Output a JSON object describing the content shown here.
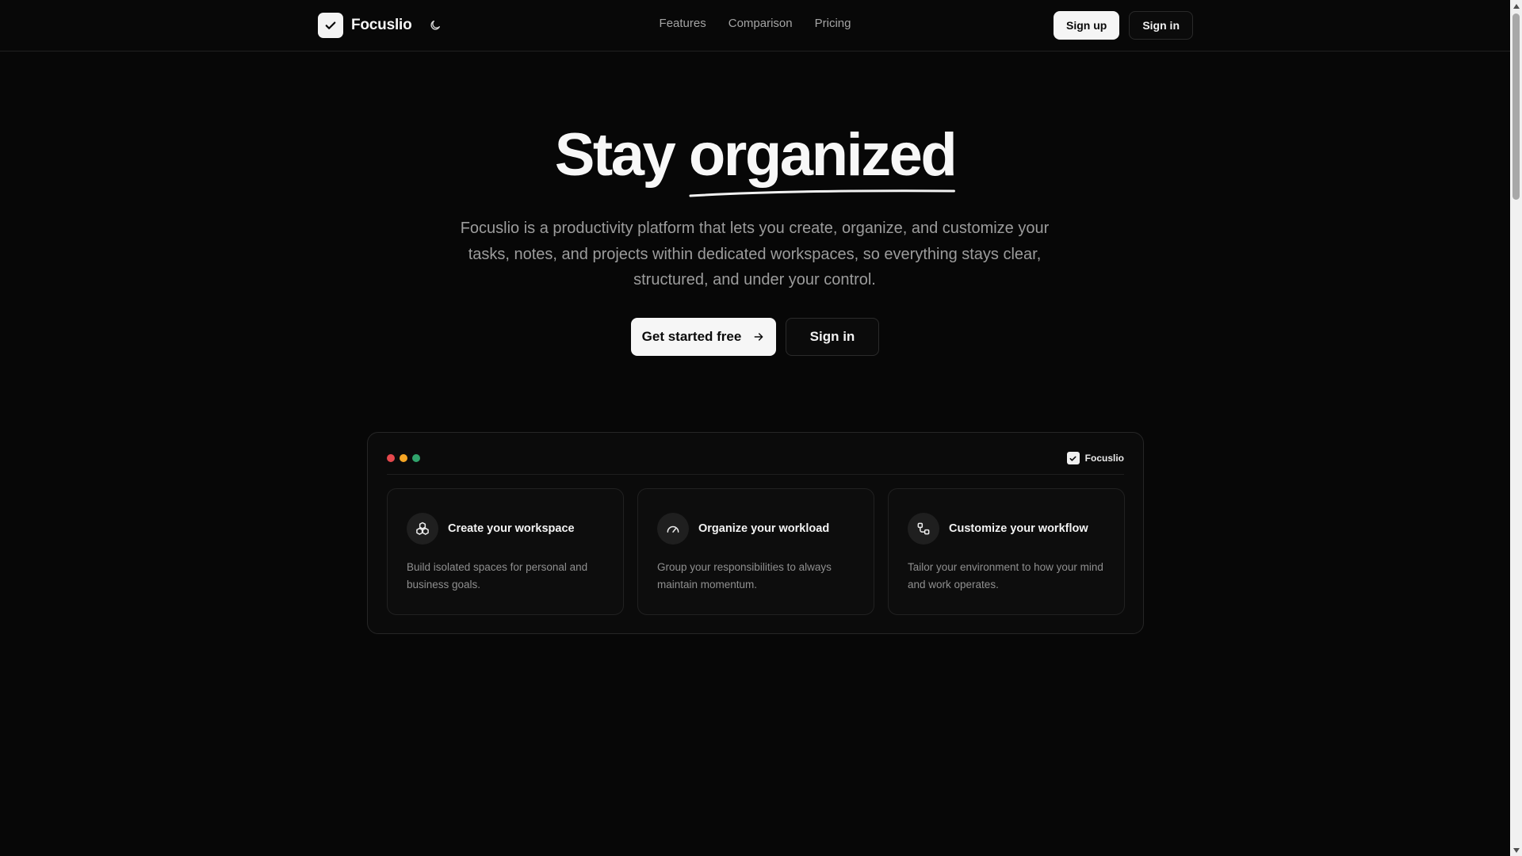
{
  "header": {
    "brand_name": "Focuslio",
    "nav": [
      "Features",
      "Comparison",
      "Pricing"
    ],
    "signup_label": "Sign up",
    "signin_label": "Sign in"
  },
  "hero": {
    "title_part1": "Stay",
    "title_highlight": "organized",
    "description": "Focuslio is a productivity platform that lets you create, organize, and customize your tasks, notes, and projects within dedicated workspaces, so everything stays clear, structured, and under your control.",
    "primary_cta": "Get started free",
    "secondary_cta": "Sign in"
  },
  "preview": {
    "brand_name": "Focuslio",
    "dot_colors": [
      "#e5484d",
      "#f5a524",
      "#30a46c"
    ],
    "cards": [
      {
        "icon": "workspace-icon",
        "title": "Create your workspace",
        "description": "Build isolated spaces for personal and business goals."
      },
      {
        "icon": "gauge-icon",
        "title": "Organize your workload",
        "description": "Group your responsibilities to always maintain momentum."
      },
      {
        "icon": "workflow-icon",
        "title": "Customize your workflow",
        "description": "Tailor your environment to how your mind and work operates."
      }
    ]
  },
  "colors": {
    "background": "#070707",
    "text": "#f7f7f7",
    "muted": "#9c9c9c",
    "button_light": "#f6f6f6"
  }
}
